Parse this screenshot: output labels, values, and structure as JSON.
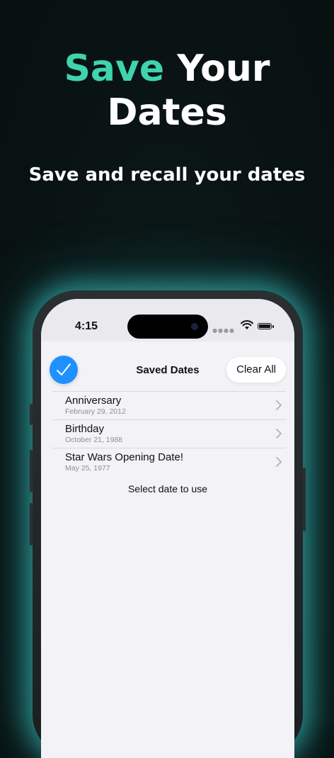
{
  "promo": {
    "headline_accent": "Save",
    "headline_rest_1": "Your",
    "headline_rest_2": "Dates",
    "subtitle": "Save and recall your dates",
    "accent_color": "#3fd3ae"
  },
  "status_bar": {
    "time": "4:15",
    "icons": [
      "cellular-dots-icon",
      "wifi-icon",
      "battery-icon"
    ]
  },
  "nav": {
    "title": "Saved Dates",
    "clear_label": "Clear All",
    "done_icon": "checkmark-icon"
  },
  "saved_dates": [
    {
      "title": "Anniversary",
      "date": "February 29, 2012"
    },
    {
      "title": "Birthday",
      "date": "October 21, 1988"
    },
    {
      "title": "Star Wars Opening Date!",
      "date": "May 25, 1977"
    }
  ],
  "hint": "Select date to use"
}
